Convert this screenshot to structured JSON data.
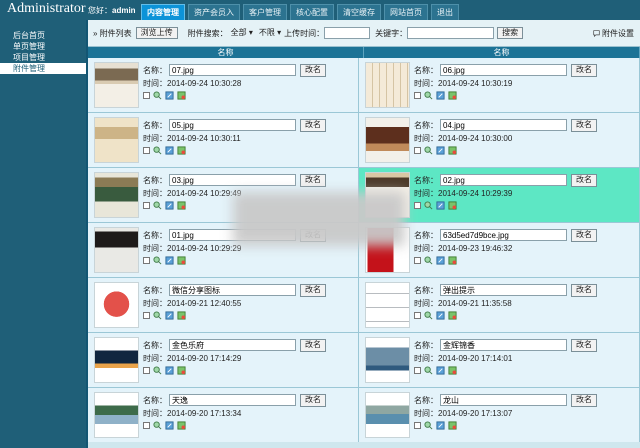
{
  "header": {
    "brand": "Administrator",
    "greeting": "您好：",
    "user": "admin",
    "tabs": [
      "内容管理",
      "资产会员入",
      "客户管理",
      "核心配置",
      "清空缓存",
      "网站首页",
      "退出"
    ],
    "active_tab": 0
  },
  "sidebar": {
    "items": [
      {
        "label": "后台首页",
        "active": false
      },
      {
        "label": "单页管理",
        "active": false
      },
      {
        "label": "项目管理",
        "active": false
      },
      {
        "label": "附件管理",
        "active": true
      }
    ]
  },
  "toolbar": {
    "crumb": "» 附件列表",
    "upload": "浏览上传",
    "search_label": "附件搜索：",
    "filter_all": "全部",
    "filter_limit": "不限",
    "upload_time_label": "上传时间：",
    "keyword_label": "关键字：",
    "search_button": "搜索",
    "settings": "附件设置"
  },
  "columns": [
    "名称",
    "名称"
  ],
  "labels": {
    "name": "名称：",
    "time": "时间：",
    "rename": "改名"
  },
  "files": [
    {
      "name": "07.jpg",
      "time": "2014-09-24 10:30:28",
      "thumb": "hotel-lobby",
      "selected": false
    },
    {
      "name": "06.jpg",
      "time": "2014-09-24 10:30:19",
      "thumb": "floor-plan",
      "selected": false
    },
    {
      "name": "05.jpg",
      "time": "2014-09-24 10:30:11",
      "thumb": "brochure",
      "selected": false
    },
    {
      "name": "04.jpg",
      "time": "2014-09-24 10:30:00",
      "thumb": "interior",
      "selected": false
    },
    {
      "name": "03.jpg",
      "time": "2014-09-24 10:29:49",
      "thumb": "building",
      "selected": false
    },
    {
      "name": "02.jpg",
      "time": "2014-09-24 10:29:39",
      "thumb": "room",
      "selected": true
    },
    {
      "name": "01.jpg",
      "time": "2014-09-24 10:29:29",
      "thumb": "cover",
      "selected": false
    },
    {
      "name": "63d5ed7d9bce.jpg",
      "time": "2014-09-23 19:46:32",
      "thumb": "red-poster",
      "selected": false
    },
    {
      "name": "微信分享图标",
      "time": "2014-09-21 12:40:55",
      "thumb": "red-logo",
      "selected": false
    },
    {
      "name": "弹出提示",
      "time": "2014-09-21 11:35:58",
      "thumb": "text-tip",
      "selected": false
    },
    {
      "name": "金色乐府",
      "time": "2014-09-20 17:14:29",
      "thumb": "panorama-night",
      "selected": false
    },
    {
      "name": "金辉锦香",
      "time": "2014-09-20 17:14:01",
      "thumb": "skyline",
      "selected": false
    },
    {
      "name": "天逸",
      "time": "2014-09-20 17:13:34",
      "thumb": "lake-view",
      "selected": false
    },
    {
      "name": "龙山",
      "time": "2014-09-20 17:13:07",
      "thumb": "mountain-lake",
      "selected": false
    }
  ],
  "colors": {
    "accent": "#0c93d8",
    "header": "#1f5f78",
    "selected_row": "#5de7c4"
  }
}
